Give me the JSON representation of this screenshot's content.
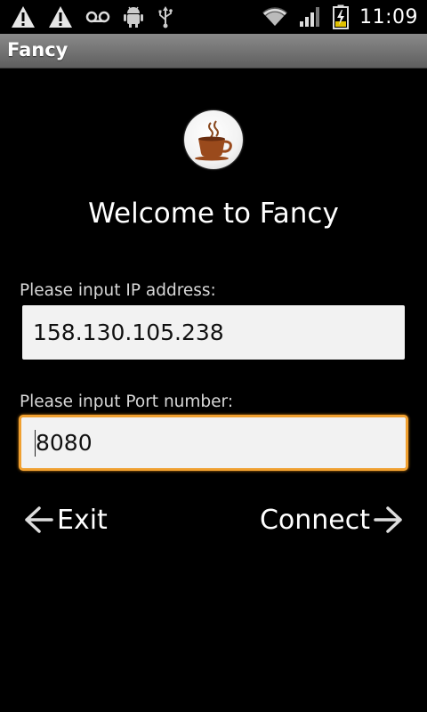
{
  "status_bar": {
    "time": "11:09",
    "icons": [
      "warning-icon",
      "warning-icon",
      "voicemail-icon",
      "android-debug-icon",
      "usb-icon",
      "wifi-icon",
      "signal-icon",
      "battery-charging-icon"
    ]
  },
  "app": {
    "title": "Fancy"
  },
  "main": {
    "logo_icon": "coffee-cup-icon",
    "welcome": "Welcome to Fancy",
    "ip_label": "Please input IP address:",
    "ip_value": "158.130.105.238",
    "port_label": "Please input Port number:",
    "port_value": "8080"
  },
  "actions": {
    "exit_label": "Exit",
    "connect_label": "Connect"
  },
  "colors": {
    "focus_border": "#f0a030",
    "background": "#000000",
    "title_bar": "#707070"
  }
}
